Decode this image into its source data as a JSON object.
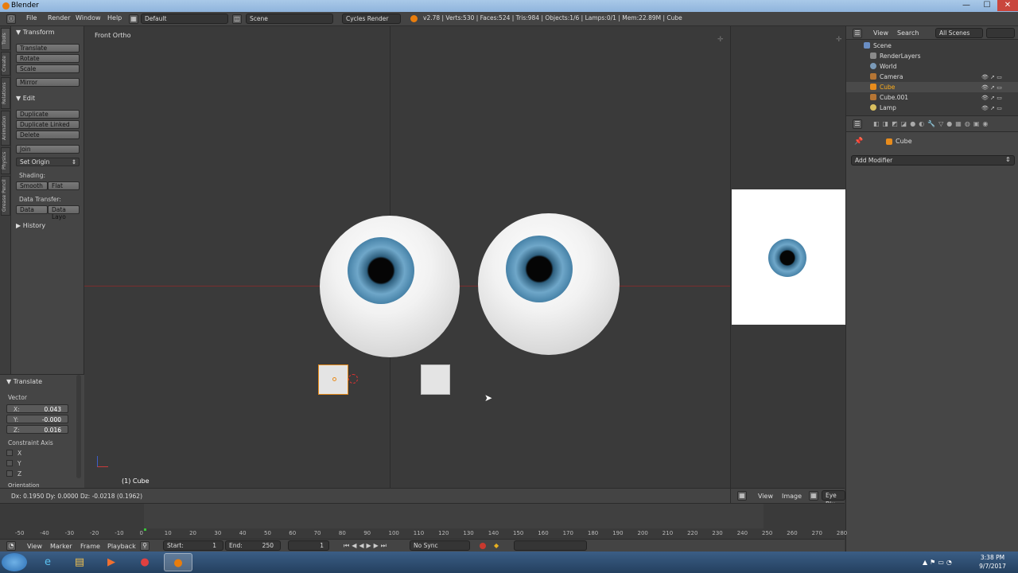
{
  "window": {
    "title": "Blender",
    "minimize": "—",
    "maximize": "☐",
    "close": "✕"
  },
  "menubar": {
    "items": [
      "File",
      "Render",
      "Window",
      "Help"
    ],
    "layout": "Default",
    "scene": "Scene",
    "engine": "Cycles Render",
    "stats": "v2.78 | Verts:530 | Faces:524 | Tris:984 | Objects:1/6 | Lamps:0/1 | Mem:22.89M | Cube"
  },
  "tabs": [
    "Tools",
    "Create",
    "Relations",
    "Animation",
    "Physics",
    "Grease Pencil"
  ],
  "toolshelf": {
    "transform_title": "Transform",
    "transform": [
      "Translate",
      "Rotate",
      "Scale"
    ],
    "mirror": "Mirror",
    "edit_title": "Edit",
    "edit": [
      "Duplicate",
      "Duplicate Linked",
      "Delete"
    ],
    "join": "Join",
    "set_origin": "Set Origin",
    "shading_label": "Shading:",
    "smooth": "Smooth",
    "flat": "Flat",
    "data_transfer_label": "Data Transfer:",
    "data": "Data",
    "data_layo": "Data Layo",
    "history": "History"
  },
  "operator": {
    "title": "Translate",
    "vector_label": "Vector",
    "x_label": "X:",
    "x_value": "0.043",
    "y_label": "Y:",
    "y_value": "-0.000",
    "z_label": "Z:",
    "z_value": "0.016",
    "constraint_label": "Constraint Axis",
    "axes": [
      "X",
      "Y",
      "Z"
    ],
    "orientation_label": "Orientation"
  },
  "viewport": {
    "view_name": "Front Ortho",
    "active_object": "(1) Cube"
  },
  "status": "Dx: 0.1950  Dy: 0.0000  Dz: -0.0218 (0.1962)",
  "image_header": {
    "view": "View",
    "image": "Image",
    "image_name": "Eye Blu"
  },
  "outliner": {
    "view": "View",
    "search": "Search",
    "scenes": "All Scenes",
    "items": [
      "Scene",
      "RenderLayers",
      "World",
      "Camera",
      "Cube",
      "Cube.001",
      "Lamp"
    ]
  },
  "properties": {
    "object": "Cube",
    "add_modifier": "Add Modifier"
  },
  "timeline": {
    "ticks": [
      "-50",
      "-40",
      "-30",
      "-20",
      "-10",
      "0",
      "10",
      "20",
      "30",
      "40",
      "50",
      "60",
      "70",
      "80",
      "90",
      "100",
      "110",
      "120",
      "130",
      "140",
      "150",
      "160",
      "170",
      "180",
      "190",
      "200",
      "210",
      "220",
      "230",
      "240",
      "250",
      "260",
      "270",
      "280"
    ],
    "menu": [
      "View",
      "Marker",
      "Frame",
      "Playback"
    ],
    "start_label": "Start:",
    "start": "1",
    "end_label": "End:",
    "end": "250",
    "current": "1",
    "sync": "No Sync"
  },
  "taskbar": {
    "time": "3:38 PM",
    "date": "9/7/2017"
  },
  "colors": {
    "accent": "#e87d0d",
    "selection_text": "#ffae1a",
    "timeline_cursor": "#3ac43a"
  }
}
